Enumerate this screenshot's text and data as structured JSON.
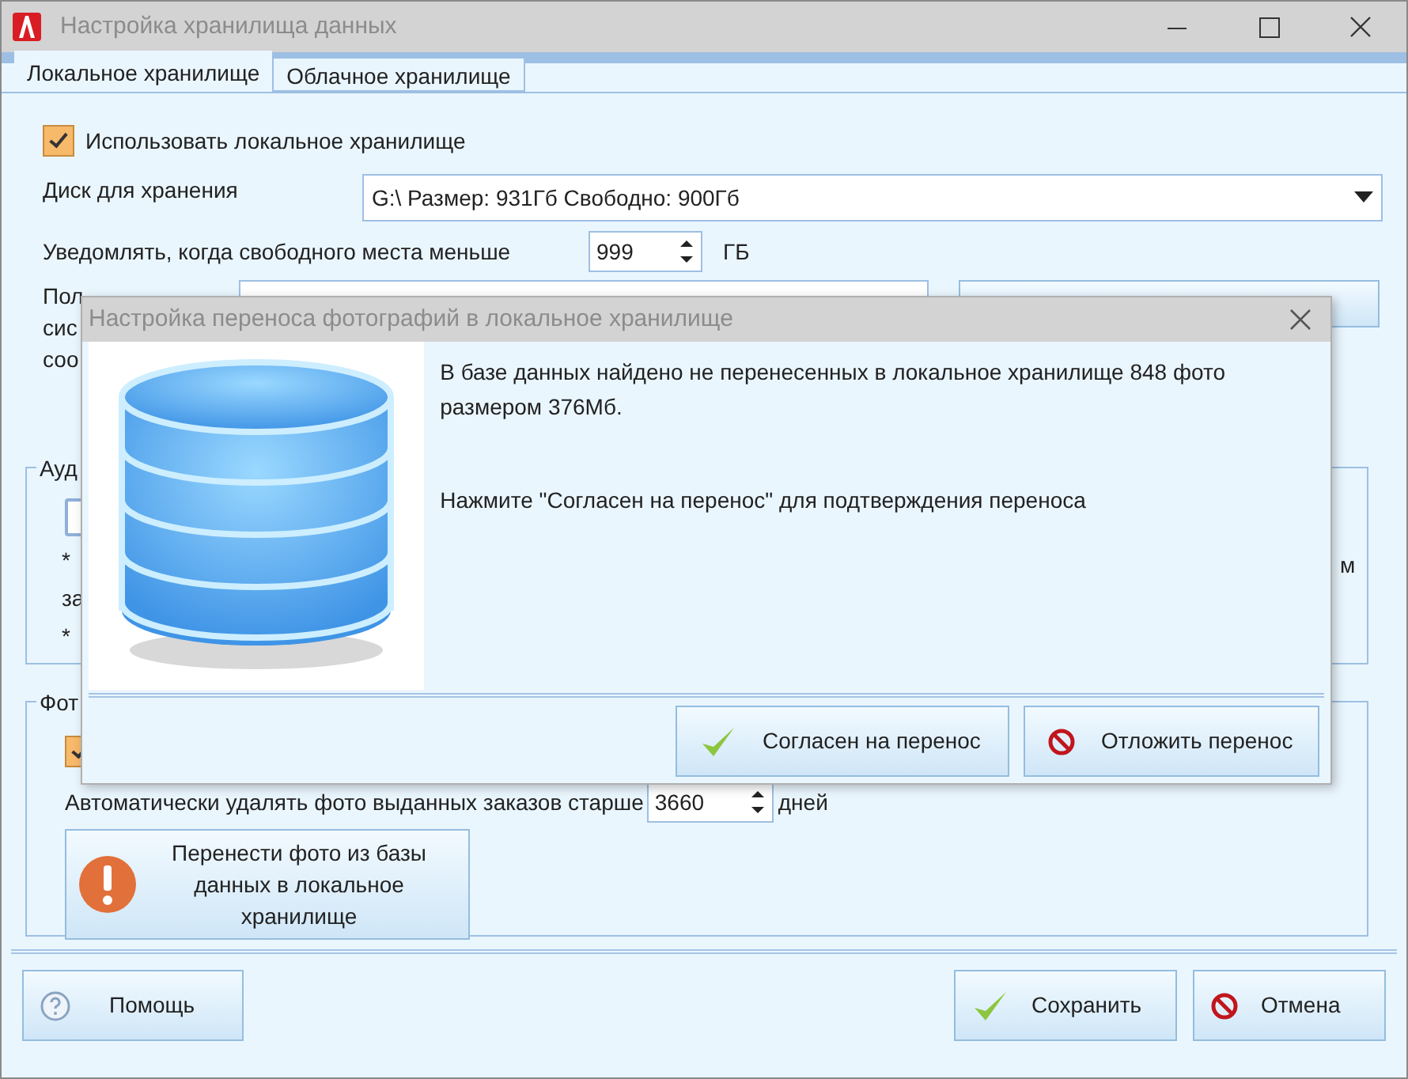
{
  "window": {
    "title": "Настройка хранилища данных"
  },
  "tabs": [
    {
      "label": "Локальное хранилище",
      "selected": true
    },
    {
      "label": "Облачное хранилище",
      "selected": false
    }
  ],
  "use_local": {
    "label": "Использовать локальное хранилище",
    "checked": true
  },
  "disk": {
    "label": "Диск для хранения",
    "value": "G:\\ Размер: 931Гб Свободно: 900Гб"
  },
  "notify": {
    "label": "Уведомлять, когда свободного места меньше",
    "value": "999",
    "unit": "ГБ"
  },
  "path_label_lines": [
    "Пол",
    "сис",
    "соо"
  ],
  "audio_group": {
    "legend": "Ауд",
    "lines": [
      "*",
      "за",
      "*"
    ],
    "right_fragment": "м"
  },
  "photo_group": {
    "legend": "Фот",
    "checkbox": {
      "checked": true
    },
    "auto_delete": {
      "label": "Автоматически удалять фото выданных заказов старше",
      "value": "3660",
      "unit": "дней"
    },
    "move_button": "Перенести фото из базы данных в локальное хранилище"
  },
  "footer_buttons": [
    {
      "label": "Помощь"
    },
    {
      "label": "Сохранить"
    },
    {
      "label": "Отмена"
    }
  ],
  "dialog": {
    "title": "Настройка переноса фотографий в локальное хранилище",
    "message": "В базе данных найдено не перенесенных в локальное хранилище 848 фото размером 376Мб.",
    "hint": "Нажмите \"Согласен на перенос\" для подтверждения переноса",
    "buttons": [
      {
        "label": "Согласен на перенос"
      },
      {
        "label": "Отложить перенос"
      }
    ]
  }
}
